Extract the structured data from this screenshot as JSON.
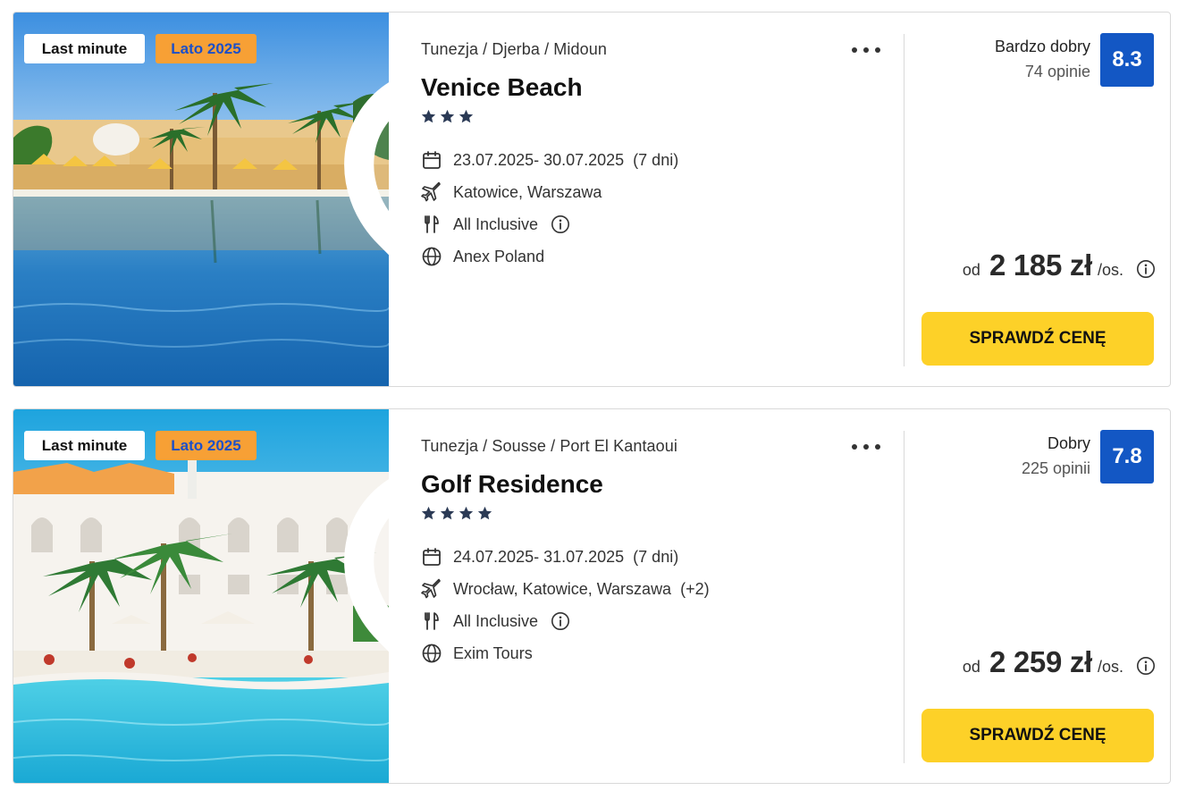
{
  "colors": {
    "badge_season_bg": "#f7a035",
    "badge_season_text": "#1d50c8",
    "score_bg": "#1357c4",
    "cta_bg": "#fdd128",
    "border": "#d9d9d9"
  },
  "icons": {
    "favorite": "heart-icon",
    "more": "more-dots-icon",
    "dates": "calendar-icon",
    "airport": "plane-icon",
    "board": "cutlery-icon",
    "operator": "globe-icon",
    "info": "info-icon",
    "star": "star-icon"
  },
  "offers": [
    {
      "badges": {
        "last_minute": "Last minute",
        "season": "Lato 2025"
      },
      "location": "Tunezja / Djerba / Midoun",
      "hotel_name": "Venice Beach",
      "stars": 3,
      "dates": "23.07.2025- 30.07.2025",
      "duration": "(7 dni)",
      "airports": "Katowice, Warszawa",
      "airports_extra": "",
      "board": "All Inclusive",
      "operator": "Anex Poland",
      "rating_label": "Bardzo dobry",
      "rating_count": "74 opinie",
      "score": "8.3",
      "price_prefix": "od",
      "price": "2 185 zł",
      "price_unit": "/os.",
      "cta_label": "SPRAWDŹ CENĘ"
    },
    {
      "badges": {
        "last_minute": "Last minute",
        "season": "Lato 2025"
      },
      "location": "Tunezja / Sousse / Port El Kantaoui",
      "hotel_name": "Golf Residence",
      "stars": 4,
      "dates": "24.07.2025- 31.07.2025",
      "duration": "(7 dni)",
      "airports": "Wrocław, Katowice, Warszawa",
      "airports_extra": "(+2)",
      "board": "All Inclusive",
      "operator": "Exim Tours",
      "rating_label": "Dobry",
      "rating_count": "225 opinii",
      "score": "7.8",
      "price_prefix": "od",
      "price": "2 259 zł",
      "price_unit": "/os.",
      "cta_label": "SPRAWDŹ CENĘ"
    }
  ]
}
